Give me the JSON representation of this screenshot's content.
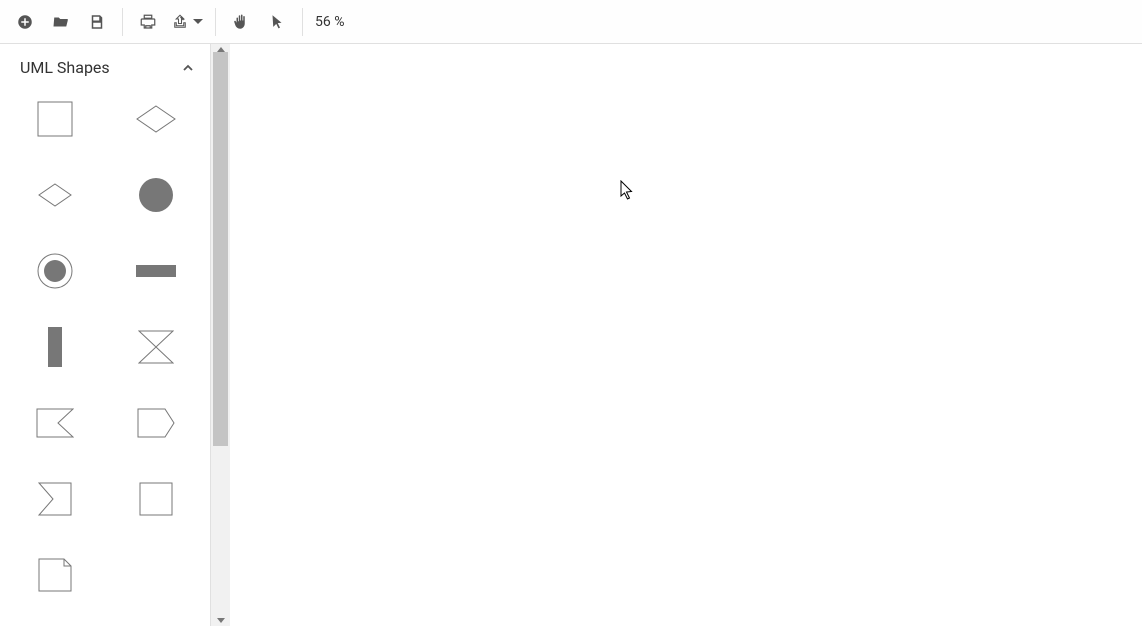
{
  "toolbar": {
    "zoom_label": "56 %"
  },
  "sidebar": {
    "panel_title": "UML Shapes",
    "shapes": [
      {
        "id": "rectangle"
      },
      {
        "id": "diamond"
      },
      {
        "id": "diamond-small"
      },
      {
        "id": "circle-filled"
      },
      {
        "id": "circle-ringed"
      },
      {
        "id": "bar-horizontal"
      },
      {
        "id": "bar-vertical"
      },
      {
        "id": "hourglass"
      },
      {
        "id": "receive-signal"
      },
      {
        "id": "send-signal"
      },
      {
        "id": "flag"
      },
      {
        "id": "square"
      },
      {
        "id": "note"
      }
    ]
  }
}
